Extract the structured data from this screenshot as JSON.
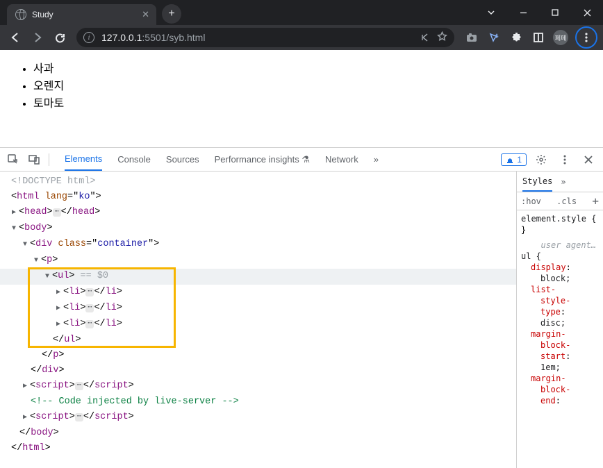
{
  "browser": {
    "tab_title": "Study",
    "url_host": "127.0.0.1",
    "url_port_path": ":5501/syb.html",
    "profile_label": "페페"
  },
  "page": {
    "list_items": [
      "사과",
      "오렌지",
      "토마토"
    ]
  },
  "devtools": {
    "tabs": [
      "Elements",
      "Console",
      "Sources",
      "Performance insights",
      "Network"
    ],
    "active_tab": "Elements",
    "issues_count": "1",
    "dom": {
      "doctype": "<!DOCTYPE html>",
      "html_open": "<html lang=\"ko\">",
      "head": "<head>",
      "head_close": "</head>",
      "body": "<body>",
      "div_open": "<div class=\"container\">",
      "p_open": "<p>",
      "ul_open": "<ul>",
      "eq0": "== $0",
      "li": "<li>",
      "li_close": "</li>",
      "ul_close": "</ul>",
      "p_close": "</p>",
      "div_close": "</div>",
      "script": "<script>",
      "script_close": "</script>",
      "comment": "<!-- Code injected by live-server -->",
      "body_close": "</body>",
      "html_close": "</html>"
    },
    "styles": {
      "panel_tab": "Styles",
      "hov": ":hov",
      "cls": ".cls",
      "element_style": "element.style {",
      "brace_close": "}",
      "ua_label": "user agent…",
      "ul_sel": "ul {",
      "rules": [
        {
          "prop": "display",
          "val": "block;"
        },
        {
          "prop": "list-style-type",
          "val": "disc;"
        },
        {
          "prop": "margin-block-start",
          "val": "1em;"
        },
        {
          "prop": "margin-block-end",
          "val": ""
        }
      ]
    }
  }
}
